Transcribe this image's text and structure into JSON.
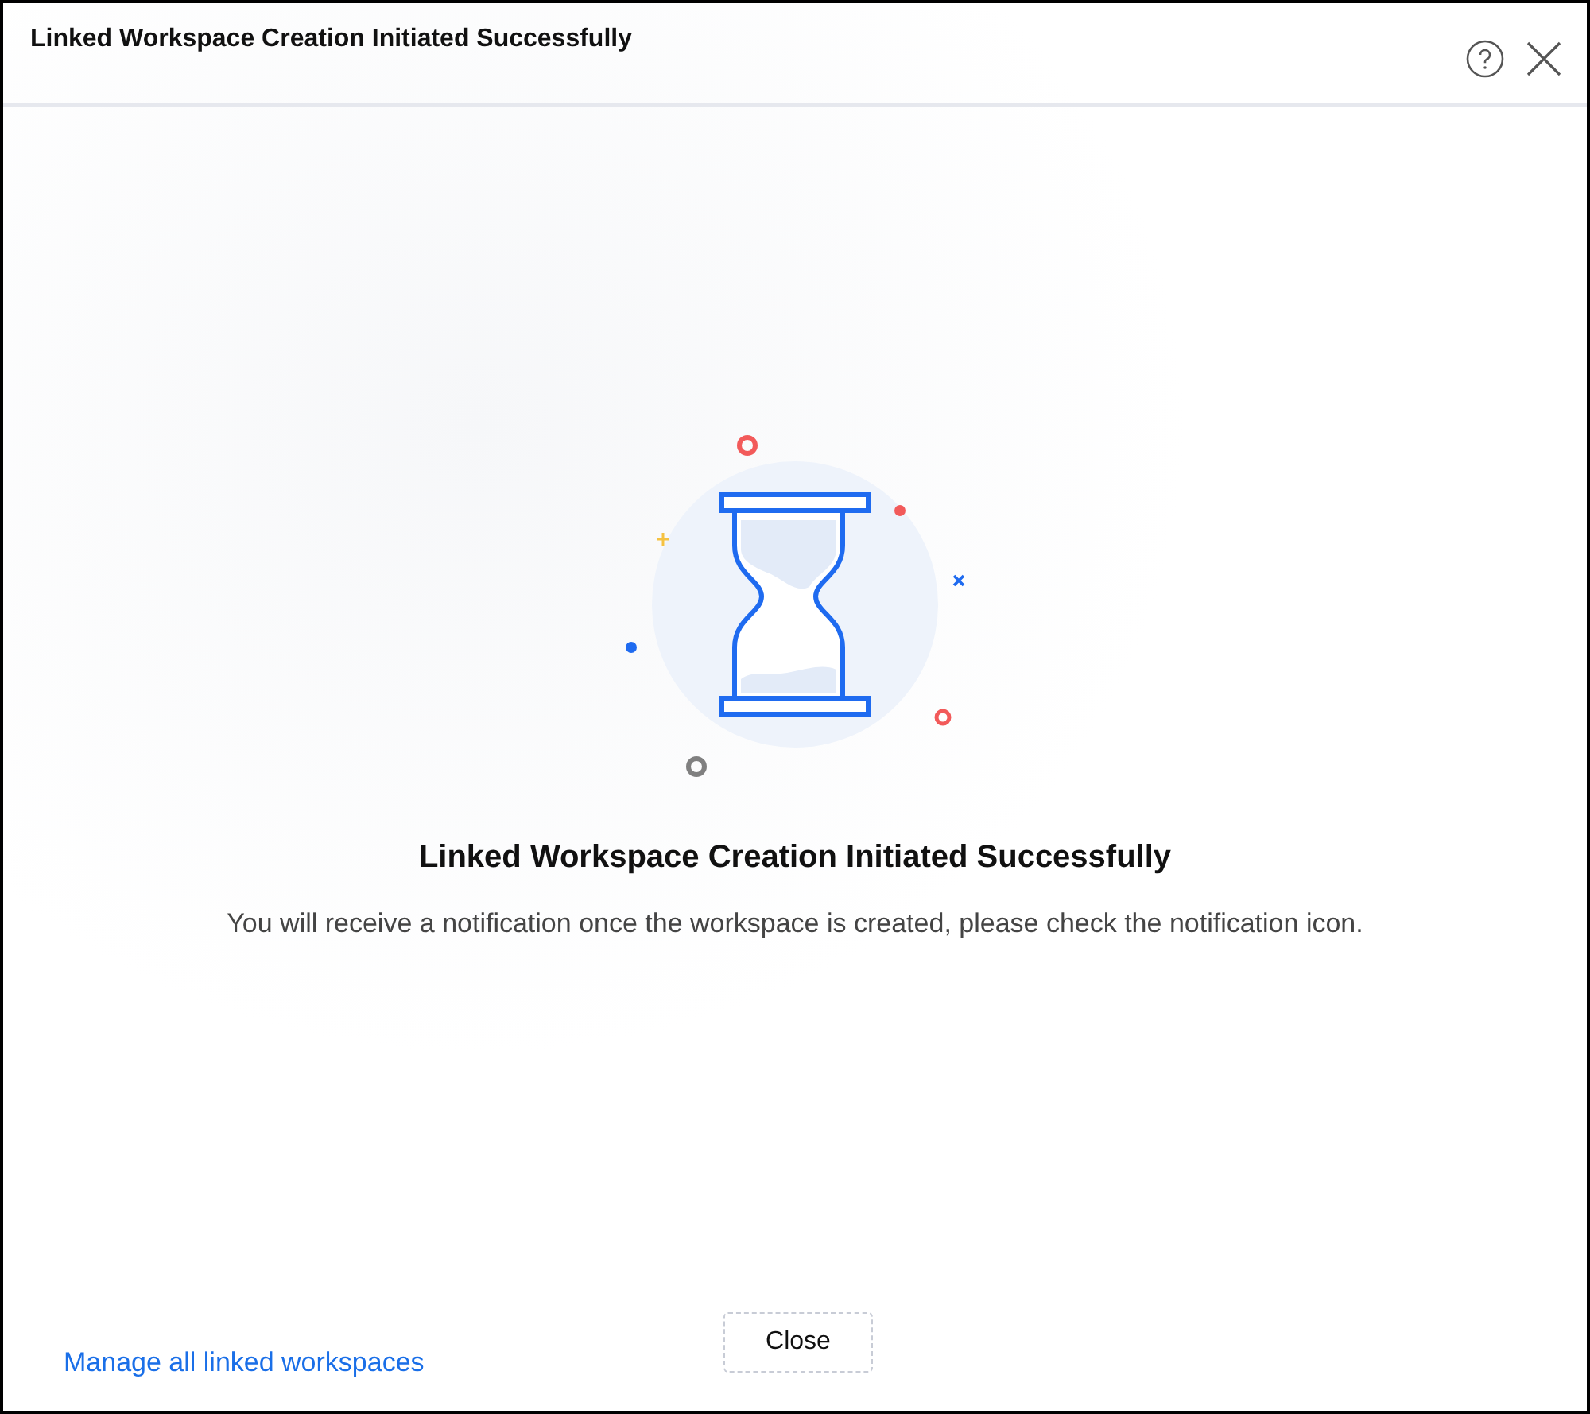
{
  "dialog": {
    "title": "Linked Workspace Creation Initiated Successfully"
  },
  "message": {
    "heading": "Linked Workspace Creation Initiated Successfully",
    "text": "You will receive a notification once the workspace is created, please check the notification icon."
  },
  "footer": {
    "link": "Manage all linked workspaces",
    "button": "Close"
  }
}
